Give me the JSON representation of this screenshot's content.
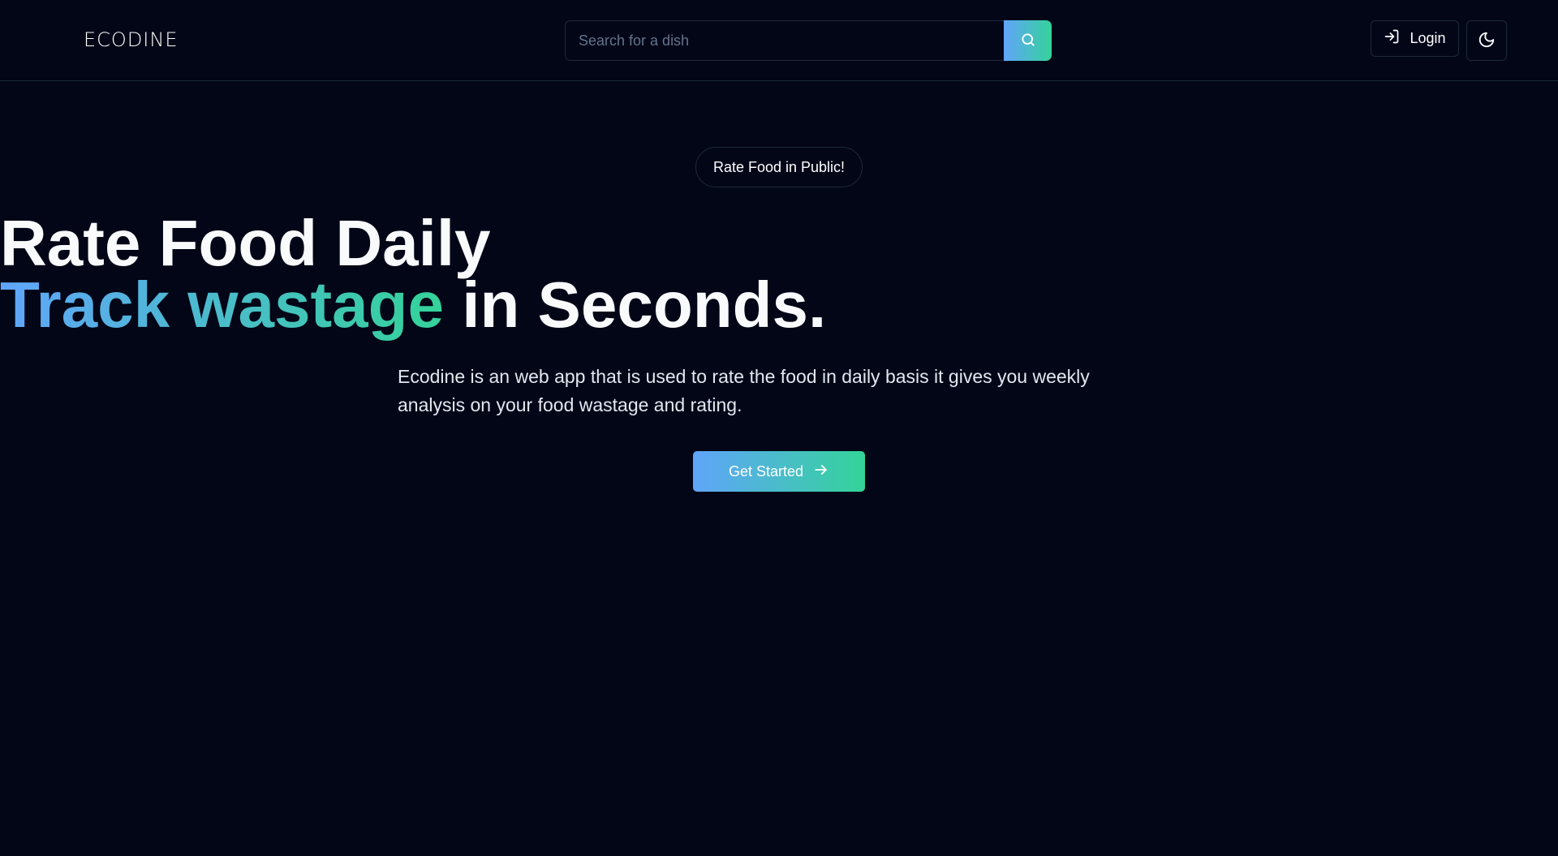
{
  "navbar": {
    "logo_text": "ECODINE",
    "search": {
      "placeholder": "Search for a dish",
      "value": "",
      "button_icon": "search-icon"
    },
    "login": {
      "label": "Login",
      "icon": "login-icon"
    },
    "theme_toggle": {
      "icon": "moon-icon"
    }
  },
  "hero": {
    "badge": "Rate Food in Public!",
    "headline_line1": "Rate Food Daily",
    "headline_line2_highlight": "Track wastage",
    "headline_line2_rest": "in Seconds.",
    "description": "Ecodine is an web app that is used to rate the food in daily basis it gives you weekly analysis on your food wastage and rating.",
    "cta": {
      "label": "Get Started",
      "icon": "arrow-right-icon"
    }
  },
  "colors": {
    "background": "#020617",
    "border": "#1e293b",
    "gradient_start": "#60a5fa",
    "gradient_end": "#34d399",
    "text": "#f8fafc"
  }
}
